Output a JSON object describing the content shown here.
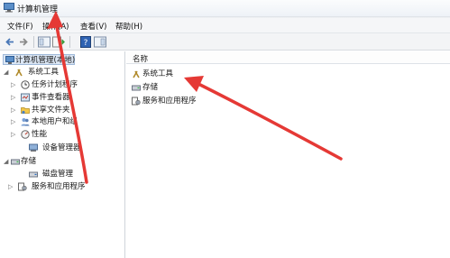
{
  "window": {
    "title": "计算机管理"
  },
  "menu": {
    "items": [
      "文件(F)",
      "操作(A)",
      "查看(V)",
      "帮助(H)"
    ]
  },
  "tree": {
    "root": "计算机管理(本地)",
    "items": [
      {
        "label": "系统工具",
        "icon": "tools-icon"
      },
      {
        "label": "任务计划程序",
        "icon": "clock-icon"
      },
      {
        "label": "事件查看器",
        "icon": "event-viewer-icon"
      },
      {
        "label": "共享文件夹",
        "icon": "shared-folder-icon"
      },
      {
        "label": "本地用户和组",
        "icon": "users-icon"
      },
      {
        "label": "性能",
        "icon": "performance-icon"
      },
      {
        "label": "设备管理器",
        "icon": "device-manager-icon"
      },
      {
        "label": "存储",
        "icon": "storage-icon"
      },
      {
        "label": "磁盘管理",
        "icon": "disk-icon"
      },
      {
        "label": "服务和应用程序",
        "icon": "services-icon"
      }
    ]
  },
  "list": {
    "column_name": "名称",
    "items": [
      {
        "label": "系统工具",
        "icon": "tools-icon"
      },
      {
        "label": "存储",
        "icon": "storage-icon"
      },
      {
        "label": "服务和应用程序",
        "icon": "services-icon"
      }
    ]
  },
  "colors": {
    "annotation_arrow": "#e53935",
    "selection": "#dbe6f4"
  }
}
